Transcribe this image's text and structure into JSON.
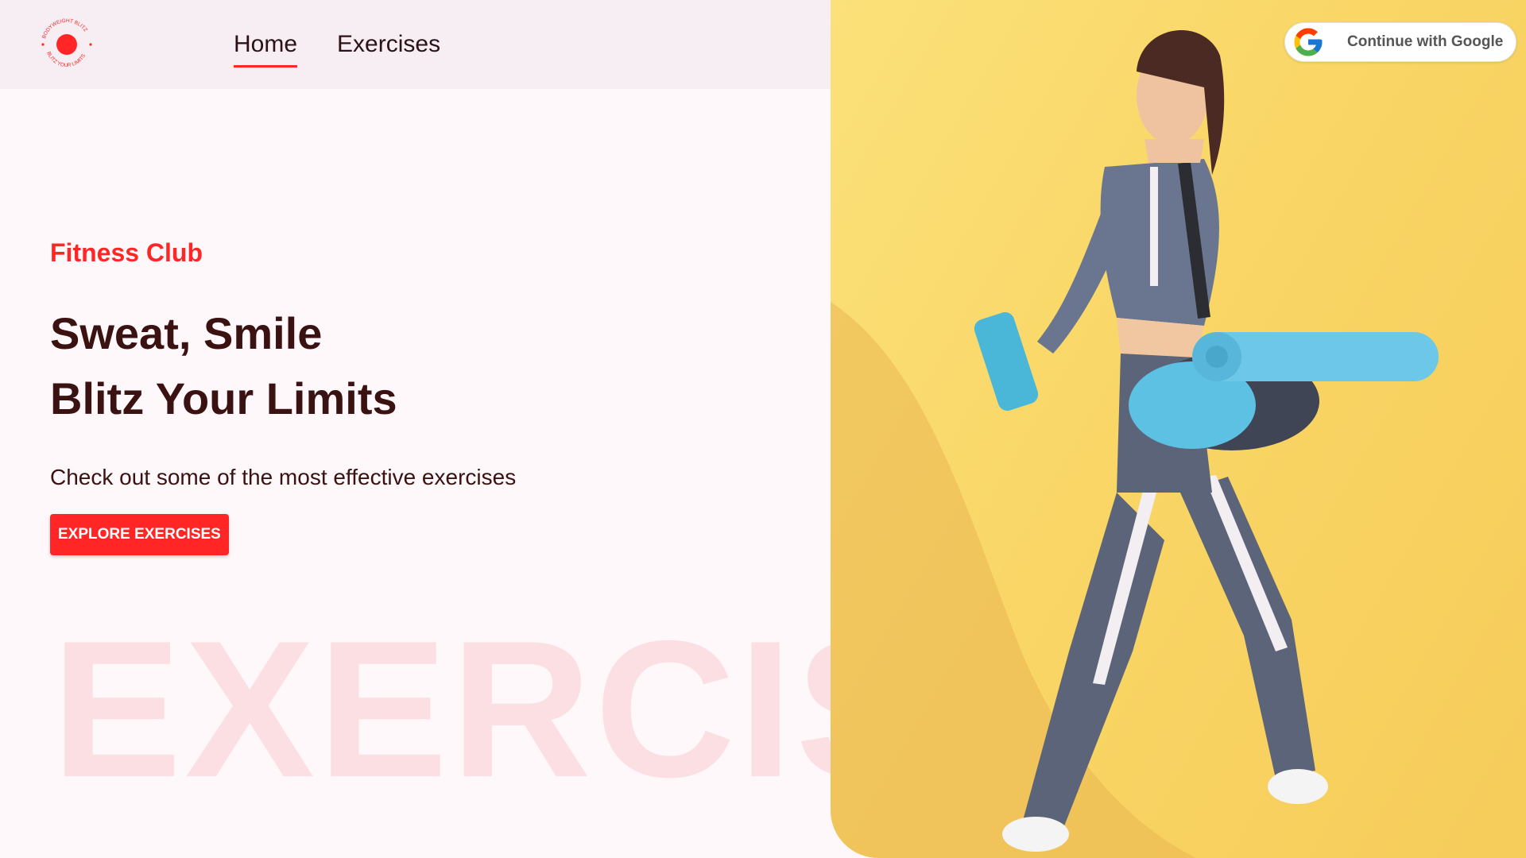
{
  "brand": {
    "logo_icon": "circle-dot-logo",
    "logo_text_top": "BODYWEIGHT BLITZ",
    "logo_text_bottom": "BLITZ YOUR LIMITS"
  },
  "nav": {
    "items": [
      {
        "label": "Home",
        "active": true
      },
      {
        "label": "Exercises",
        "active": false
      }
    ]
  },
  "auth": {
    "google_label": "Continue with Google",
    "icon": "google-icon"
  },
  "hero": {
    "eyebrow": "Fitness Club",
    "headline_line1": "Sweat, Smile",
    "headline_line2": "Blitz Your Limits",
    "subline": "Check out some of the most effective exercises",
    "cta_label": "EXPLORE EXERCISES",
    "watermark": "EXERCISE"
  },
  "colors": {
    "accent": "#ff2625",
    "heading": "#3a1212",
    "header_bg": "#f6eef3",
    "photo_bg": "#f9d666"
  }
}
